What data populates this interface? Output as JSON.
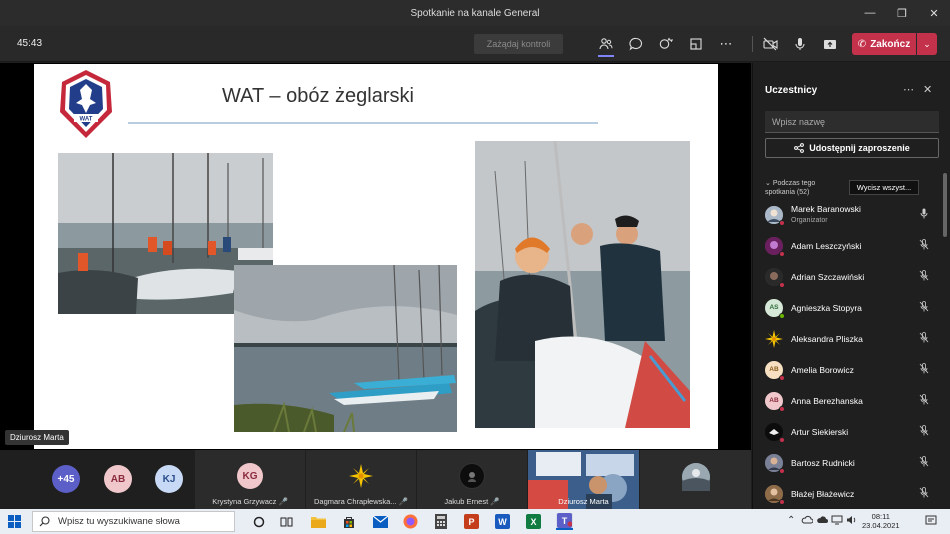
{
  "window": {
    "title": "Spotkanie na kanale General"
  },
  "toolbar": {
    "timer": "45:43",
    "request_control": "Zażądaj kontroli",
    "end_label": "Zakończ"
  },
  "slide": {
    "title": "WAT – obóz żeglarski",
    "logo_text": "WAT",
    "speaker": "Dziurosz Marta"
  },
  "strip": {
    "overflow_count": "+45",
    "avatars": [
      {
        "initials": "AB",
        "color": "#f0c8cc",
        "text": "#8a2b3d"
      },
      {
        "initials": "KJ",
        "color": "#c7d9f5",
        "text": "#2a4d8a"
      }
    ],
    "tiles": [
      {
        "name": "Krystyna Grzywacz",
        "initials": "KG",
        "color": "#f0c8cc",
        "text": "#8a2b3d"
      },
      {
        "name": "Dagmara Chrapłewska...",
        "initials": "",
        "color": "#2b2b2b",
        "text": "#fff"
      },
      {
        "name": "Jakub Ernest",
        "initials": "",
        "color": "#111",
        "text": "#fff"
      },
      {
        "name": "Dziurosz Marta",
        "initials": "",
        "color": "#6b8fb0",
        "text": "#fff"
      }
    ]
  },
  "panel": {
    "title": "Uczestnicy",
    "search_placeholder": "Wpisz nazwę",
    "share_label": "Udostępnij zaproszenie",
    "section_label": "Podczas tego spotkania (52)",
    "mute_all": "Wycisz wszyst...",
    "participants": [
      {
        "name": "Marek Baranowski",
        "role": "Organizator",
        "initials": "",
        "color": "#7a8ea6",
        "text": "#fff",
        "mic": "on"
      },
      {
        "name": "Adam Leszczyński",
        "role": "",
        "initials": "",
        "color": "#8e2b7a",
        "text": "#fff",
        "mic": "off"
      },
      {
        "name": "Adrian Szczawiński",
        "role": "",
        "initials": "",
        "color": "#3a3a3a",
        "text": "#fff",
        "mic": "off"
      },
      {
        "name": "Agnieszka Stopyra",
        "role": "",
        "initials": "AS",
        "color": "#d6e8d8",
        "text": "#2e6b3a",
        "mic": "off"
      },
      {
        "name": "Aleksandra Pliszka",
        "role": "",
        "initials": "",
        "color": "#f5c400",
        "text": "#fff",
        "mic": "off"
      },
      {
        "name": "Amelia Borowicz",
        "role": "",
        "initials": "AB",
        "color": "#f7e0c2",
        "text": "#8a5a1c",
        "mic": "off"
      },
      {
        "name": "Anna Berezhanska",
        "role": "",
        "initials": "AB",
        "color": "#f0c8cc",
        "text": "#8a2b3d",
        "mic": "off"
      },
      {
        "name": "Artur Siekierski",
        "role": "",
        "initials": "",
        "color": "#1a1a1a",
        "text": "#fff",
        "mic": "off"
      },
      {
        "name": "Bartosz Rudnicki",
        "role": "",
        "initials": "",
        "color": "#5a5f7a",
        "text": "#fff",
        "mic": "off"
      },
      {
        "name": "Błażej Błażewicz",
        "role": "",
        "initials": "",
        "color": "#7a5a3a",
        "text": "#fff",
        "mic": "off"
      }
    ]
  },
  "taskbar": {
    "search_placeholder": "Wpisz tu wyszukiwane słowa",
    "time": "08:11",
    "date": "23.04.2021"
  }
}
